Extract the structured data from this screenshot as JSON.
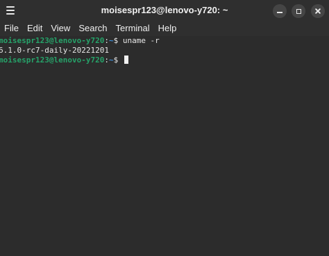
{
  "window": {
    "title": "moisespr123@lenovo-y720: ~"
  },
  "menubar": {
    "items": [
      {
        "label": "File"
      },
      {
        "label": "Edit"
      },
      {
        "label": "View"
      },
      {
        "label": "Search"
      },
      {
        "label": "Terminal"
      },
      {
        "label": "Help"
      }
    ]
  },
  "terminal": {
    "lines": [
      {
        "user_host": "moisespr123@lenovo-y720",
        "sep": ":",
        "path": "~",
        "symbol": "$",
        "command": " uname -r"
      },
      {
        "output": "6.1.0-rc7-daily-20221201"
      },
      {
        "user_host": "moisespr123@lenovo-y720",
        "sep": ":",
        "path": "~",
        "symbol": "$",
        "command": " "
      }
    ]
  },
  "colors": {
    "prompt_user": "#26a269",
    "prompt_path": "#3f8fd9",
    "background": "#2c2c2c"
  },
  "icons": {
    "menu": "hamburger-icon",
    "minimize": "minimize-icon",
    "maximize": "maximize-icon",
    "close": "close-icon"
  }
}
